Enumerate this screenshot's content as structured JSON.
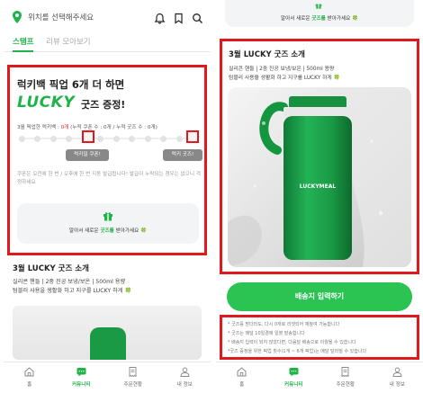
{
  "left": {
    "header": {
      "location_placeholder": "위치를 선택해주세요",
      "icons": [
        "location-pin-icon",
        "bell-icon",
        "bookmark-icon",
        "search-icon"
      ]
    },
    "tabs": [
      {
        "label": "스탬프",
        "active": true
      },
      {
        "label": "리뷰 모아보기",
        "active": false
      }
    ],
    "promo": {
      "heading_line1": "럭키백 픽업 6개 더 하면",
      "lucky_word": "LUCKY",
      "heading_line2_rest": "굿즈 증정!",
      "progress_label": "3월 픽업한 럭키백 : ",
      "progress_value": "0개",
      "progress_rest": " (누적 쿠폰 수 : 0개 / 누적 굿즈 수 : 0개)",
      "stamps_collected": 0,
      "stamps_total": 12,
      "milestone_coupon_label": "럭키밀 쿠폰!",
      "milestone_goods_label": "럭키 굿즈!",
      "note": "쿠폰은 오전에 한 번 / 오후에 한 번 지동 발급됩니다! 발급이 누락되는 경우는 없으니 걱정하세요",
      "cta_text_pre": "알아서 새로운 ",
      "cta_text_highlight": "굿즈를",
      "cta_text_post": " 받아가세요 🍀"
    },
    "goods_section": {
      "title": "3월 LUCKY 굿즈 소개",
      "desc_line1": "실리콘 핸들 | 2중 진공 보냉/보온 | 500ml 용량",
      "desc_line2": "텀블러 사용을 생활화 하고 지구를 LUCKY 하게 🍀"
    },
    "bottom_nav": [
      {
        "label": "홈",
        "icon": "home-icon",
        "active": false
      },
      {
        "label": "커뮤니티",
        "icon": "chat-icon",
        "active": true
      },
      {
        "label": "주문현황",
        "icon": "receipt-icon",
        "active": false
      },
      {
        "label": "내 정보",
        "icon": "person-icon",
        "active": false
      }
    ]
  },
  "right": {
    "top_cta_text_pre": "알아서 새로운 ",
    "top_cta_text_highlight": "굿즈를",
    "top_cta_text_post": " 받아가세요 🍀",
    "goods_section": {
      "title": "3월 LUCKY 굿즈 소개",
      "desc_line1": "실리콘 핸들 | 2중 진공 보냉/보온 | 500ml 용량",
      "desc_line2": "텀블러 사용을 생활화 하고 지구를 LUCKY 하게 🍀",
      "product_brand": "LUCKYMEAL"
    },
    "address_button": "배송지 입력하기",
    "notices": [
      "* 굿즈를 받더라도, 다시 0개로 리셋되어 재참여 가능합니다",
      "* 굿즈는 매달 10일경에 일괄 발송합니다",
      "* 배송지 입력이 되지 않았다면, 다음달 배송으로 이월될 수 있습니다",
      "*굿즈 증정을 위한 픽업 횟수(1개 ~ 6개 픽업)는 매달 달라질 수 있습니다"
    ]
  },
  "colors": {
    "brand_green": "#1fb34a",
    "button_green": "#2bc452",
    "highlight_red": "#e0191e"
  }
}
